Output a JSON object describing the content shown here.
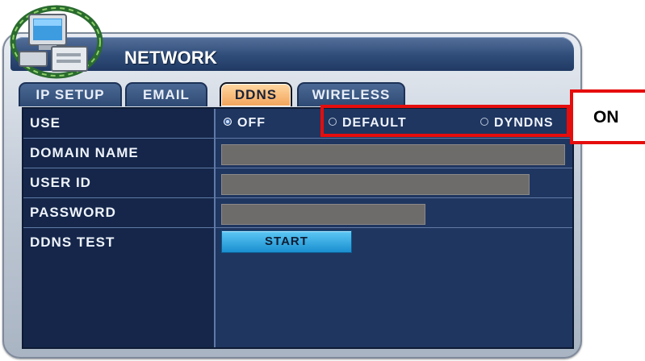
{
  "window": {
    "title": "NETWORK"
  },
  "tabs": [
    {
      "label": "IP SETUP",
      "active": false
    },
    {
      "label": "EMAIL",
      "active": false
    },
    {
      "label": "DDNS",
      "active": true
    },
    {
      "label": "WIRELESS",
      "active": false
    }
  ],
  "rows": {
    "use": {
      "label": "USE",
      "options": [
        {
          "label": "OFF",
          "checked": true
        },
        {
          "label": "DEFAULT",
          "checked": false
        },
        {
          "label": "DYNDNS",
          "checked": false
        }
      ]
    },
    "domain_name": {
      "label": "DOMAIN NAME",
      "value": ""
    },
    "user_id": {
      "label": "USER ID",
      "value": ""
    },
    "password": {
      "label": "PASSWORD",
      "value": ""
    },
    "ddns_test": {
      "label": "DDNS TEST",
      "button": "START"
    }
  },
  "annotation": {
    "label": "ON",
    "color": "#e60d0d"
  },
  "colors": {
    "panel": "#1f3660",
    "titlebar": "#2f4c79",
    "active_tab": "#f2a35a",
    "start_button": "#1a8fd0"
  }
}
